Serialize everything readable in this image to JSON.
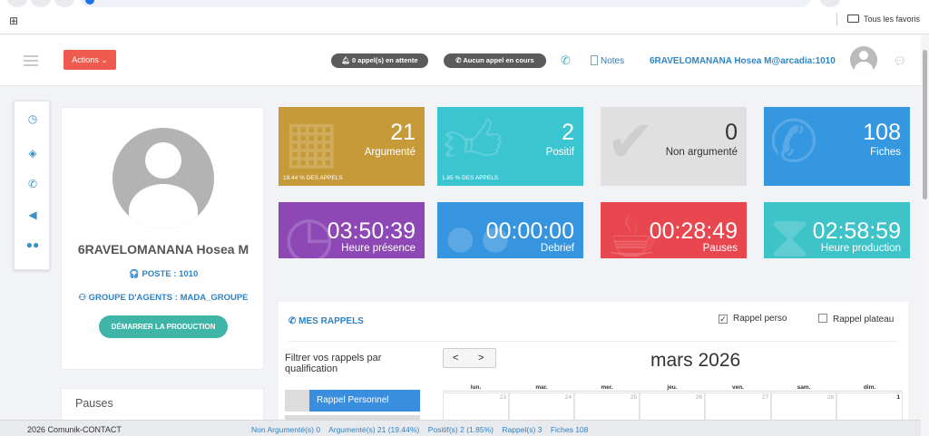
{
  "browser": {
    "bookmarks_label": "Tous les favoris"
  },
  "header": {
    "actions_label": "Actions ⌄",
    "pending_calls": "0 appel(s) en attente",
    "no_call": "Aucun appel en cours",
    "notes_label": "Notes",
    "user_label": "6RAVELOMANANA Hosea M@arcadia:1010"
  },
  "profile": {
    "name": "6RAVELOMANANA Hosea M",
    "poste": "POSTE : 1010",
    "groupe": "GROUPE D'AGENTS : MADA_GROUPE",
    "start_button": "DÉMARRER LA PRODUCTION"
  },
  "pauses_panel": {
    "title": "Pauses"
  },
  "stats_tiles": [
    {
      "value": "21",
      "label": "Argumenté",
      "sub": "19.44 % DES APPELS",
      "color": "#c79a39",
      "icon": "calendar-check-icon"
    },
    {
      "value": "2",
      "label": "Positif",
      "sub": "1.85 % DES APPELS",
      "color": "#3bc5d0",
      "icon": "thumbs-up-icon"
    },
    {
      "value": "0",
      "label": "Non argumenté",
      "sub": "",
      "color": "#e0e0e0",
      "icon": "check-circle-icon"
    },
    {
      "value": "108",
      "label": "Fiches",
      "sub": "",
      "color": "#3497e0",
      "icon": "phone-icon"
    }
  ],
  "time_tiles": [
    {
      "value": "03:50:39",
      "label": "Heure présence",
      "color": "#8d48b5",
      "icon": "clock-icon"
    },
    {
      "value": "00:00:00",
      "label": "Debrief",
      "color": "#3795e0",
      "icon": "users-icon"
    },
    {
      "value": "00:28:49",
      "label": "Pauses",
      "color": "#e9474f",
      "icon": "coffee-icon"
    },
    {
      "value": "02:58:59",
      "label": "Heure production",
      "color": "#3ec3c9",
      "icon": "hourglass-icon"
    }
  ],
  "rappels": {
    "title": "MES RAPPELS",
    "rappel_perso": "Rappel perso",
    "rappel_perso_checked": true,
    "rappel_plateau": "Rappel plateau",
    "rappel_plateau_checked": false,
    "filter_label": "Filtrer vos rappels par qualification",
    "rappel_personnel": "Rappel Personnel",
    "prev": "<",
    "next": ">",
    "month": "mars 2026",
    "weekdays": [
      "lun.",
      "mar.",
      "mer.",
      "jeu.",
      "ven.",
      "sam.",
      "dim."
    ],
    "first_row": [
      "23",
      "24",
      "25",
      "26",
      "27",
      "28",
      "1"
    ]
  },
  "footer": {
    "copyright": "2026 Comunik-CONTACT",
    "non_argumente": "Non Argumenté(s) 0",
    "argumente": "Argumenté(s) 21 (19.44%)",
    "positif": "Positif(s) 2 (1.85%)",
    "rappels": "Rappel(s) 3",
    "fiches": "Fiches 108"
  }
}
